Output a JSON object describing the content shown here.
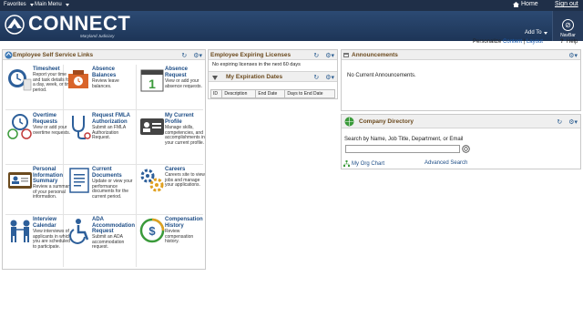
{
  "topbar": {
    "favorites": "Favorites",
    "main_menu": "Main Menu",
    "home": "Home",
    "sign_out": "Sign out"
  },
  "banner": {
    "brand": "CONNECT",
    "sub": "Maryland Judiciary",
    "add_to": "Add To",
    "navbar": "NavBar"
  },
  "util": {
    "personalize": "Personalize",
    "content": "Content",
    "sep": "|",
    "layout": "Layout",
    "help": "Help"
  },
  "ess": {
    "title": "Employee Self Service Links",
    "tiles": [
      {
        "title": "Timesheet",
        "desc": "Report your time and task details for a day, week, or time period."
      },
      {
        "title": "Absence Balances",
        "desc": "Review leave balances."
      },
      {
        "title": "Absence Request",
        "desc": "View or add your absence requests."
      },
      {
        "title": "Overtime Requests",
        "desc": "View or add your overtime requests."
      },
      {
        "title": "Request FMLA Authorization",
        "desc": "Submit an FMLA Authorization Request."
      },
      {
        "title": "My Current Profile",
        "desc": "Manage skills, competencies, and accomplishments in your current profile."
      },
      {
        "title": "Personal Information Summary",
        "desc": "Review a summary of your personal information."
      },
      {
        "title": "Current Documents",
        "desc": "Update or view your performance documents for the current period."
      },
      {
        "title": "Careers",
        "desc": "Careers site to view jobs and manage your applications."
      },
      {
        "title": "Interview Calendar",
        "desc": "View interviews of applicants in which you are scheduled to participate."
      },
      {
        "title": "ADA Accommodation Request",
        "desc": "Submit an ADA accommodation request."
      },
      {
        "title": "Compensation History",
        "desc": "Review compensation history."
      }
    ]
  },
  "licenses": {
    "title": "Employee Expiring Licenses",
    "message": "No expiring licenses in the next 60 days"
  },
  "expiration": {
    "title": "My Expiration Dates",
    "columns": [
      "ID",
      "Description",
      "End Date",
      "Days to End Date"
    ]
  },
  "announcements": {
    "title": "Announcements",
    "message": "No Current Announcements."
  },
  "directory": {
    "title": "Company Directory",
    "prompt": "Search by Name, Job Title, Department, or Email",
    "org_chart": "My Org Chart",
    "advanced": "Advanced Search"
  }
}
